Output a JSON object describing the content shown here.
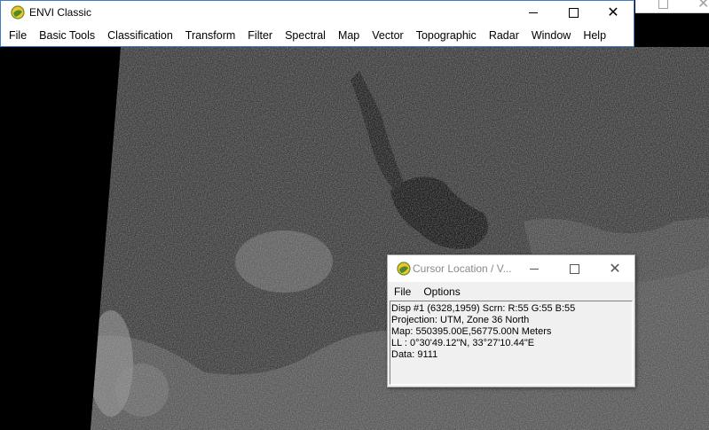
{
  "main_window": {
    "title": "ENVI Classic",
    "menu": [
      "File",
      "Basic Tools",
      "Classification",
      "Transform",
      "Filter",
      "Spectral",
      "Map",
      "Vector",
      "Topographic",
      "Radar",
      "Window",
      "Help"
    ],
    "icon": "envi-globe-icon"
  },
  "cursor_window": {
    "title": "Cursor Location / V...",
    "menu": [
      "File",
      "Options"
    ],
    "lines": [
      "Disp #1 (6328,1959) Scrn: R:55 G:55 B:55",
      "Projection: UTM, Zone 36 North",
      "Map: 550395.00E,56775.00N Meters",
      "LL : 0°30'49.12\"N, 33°27'10.44\"E",
      "Data: 9111"
    ]
  },
  "colors": {
    "background": "#000000",
    "titlebar_border": "#3c7fc4",
    "dialog_bg": "#f0f0f0"
  }
}
